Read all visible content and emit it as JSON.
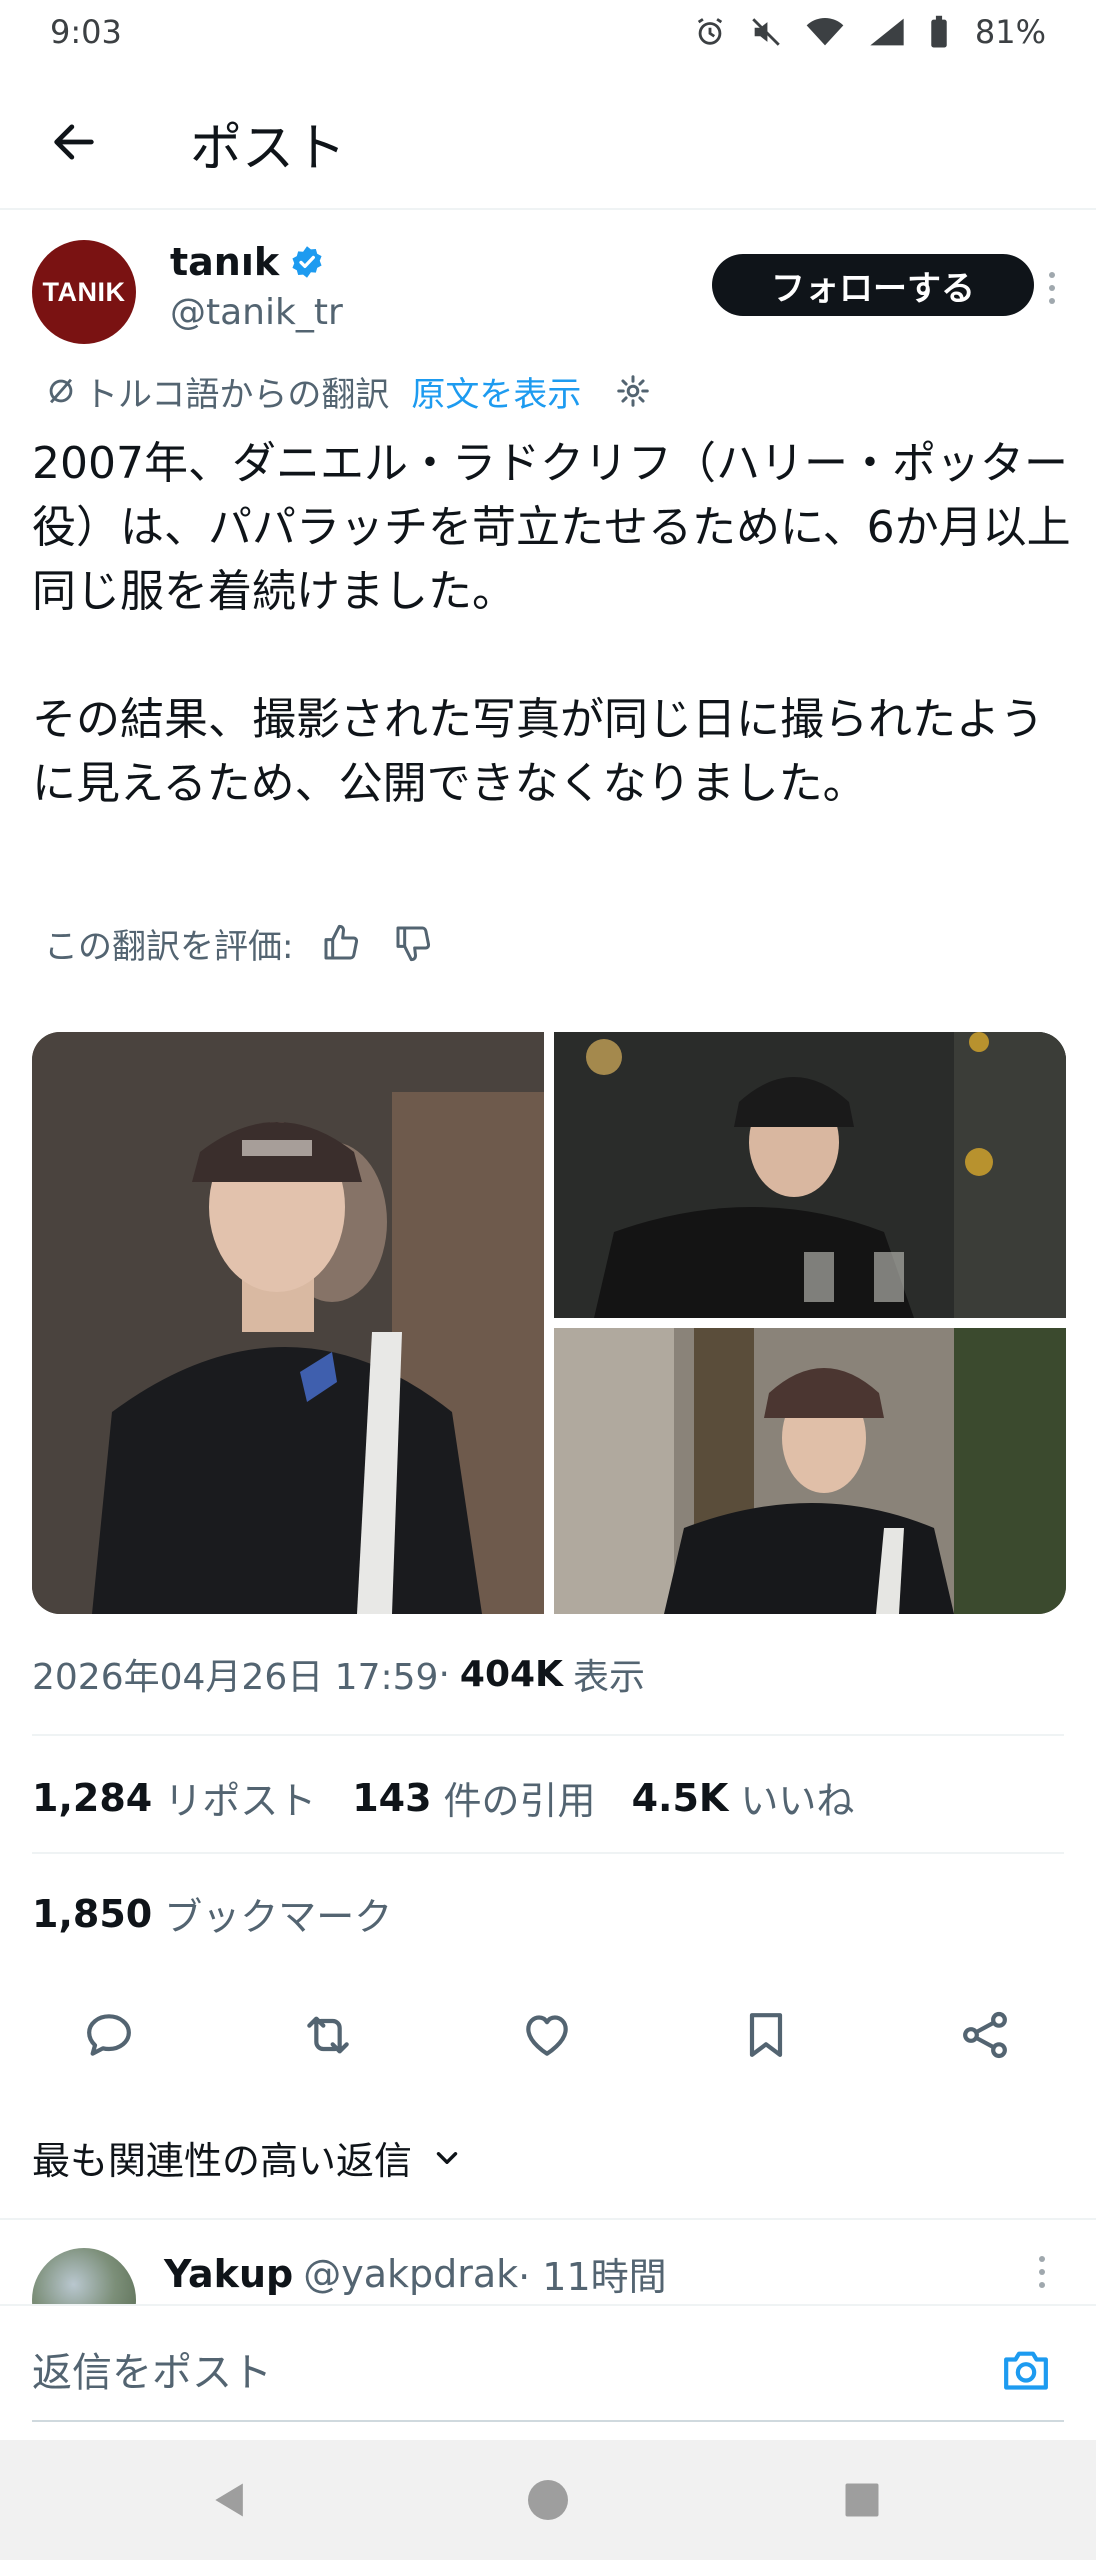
{
  "status_bar": {
    "time": "9:03",
    "battery": "81%",
    "icons": [
      "alarm-icon",
      "mute-icon",
      "wifi-icon",
      "signal-icon",
      "battery-icon"
    ]
  },
  "header": {
    "title": "ポスト",
    "back_icon": "arrow-left-icon"
  },
  "author": {
    "avatar_text": "TANIK",
    "avatar_color": "#7a1212",
    "name": "tanık",
    "handle": "@tanik_tr",
    "verified": true,
    "follow_label": "フォローする"
  },
  "translation": {
    "label": "トルコ語からの翻訳",
    "show_original": "原文を表示"
  },
  "tweet": {
    "text": "2007年、ダニエル・ラドクリフ（ハリー・ポッター役）は、パパラッチを苛立たせるために、6か月以上同じ服を着続けました。\n\nその結果、撮影された写真が同じ日に撮られたように見えるため、公開できなくなりました。"
  },
  "rate": {
    "label": "この翻訳を評価:"
  },
  "media": {
    "count": 3
  },
  "meta": {
    "datetime": "2026年04月26日 17:59",
    "separator": " · ",
    "views_count": "404K",
    "views_label": "表示"
  },
  "stats": {
    "reposts_count": "1,284",
    "reposts_label": "リポスト",
    "quotes_count": "143",
    "quotes_label": "件の引用",
    "likes_count": "4.5K",
    "likes_label": "いいね",
    "bookmarks_count": "1,850",
    "bookmarks_label": "ブックマーク"
  },
  "actions": [
    "reply-icon",
    "repost-icon",
    "like-icon",
    "bookmark-icon",
    "share-icon"
  ],
  "replies": {
    "sort_label": "最も関連性の高い返信",
    "first": {
      "name": "Yakup",
      "handle": "@yakpdrak",
      "time": " · 11時間"
    }
  },
  "reply_bar": {
    "placeholder": "返信をポスト"
  },
  "colors": {
    "accent": "#1d9bf0",
    "text": "#0f1419",
    "secondary": "#536471"
  }
}
